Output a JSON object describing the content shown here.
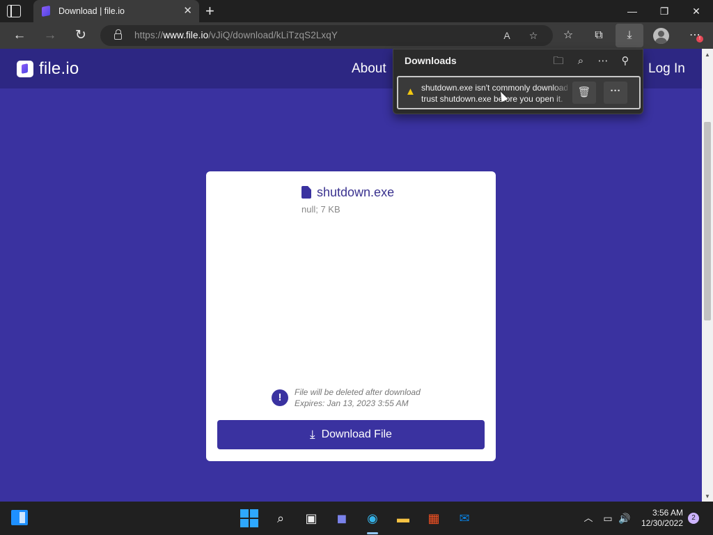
{
  "browser": {
    "tab_title": "Download | file.io",
    "url_prefix": "https://",
    "url_host": "www.file.io",
    "url_path": "/vJiQ/download/kLiTzqS2LxqY"
  },
  "site": {
    "logo_text": "file.io",
    "nav_about": "About",
    "nav_login": "Log In"
  },
  "file": {
    "name": "shutdown.exe",
    "meta": "null; 7 KB",
    "notice_line1": "File will be deleted after download",
    "notice_line2": "Expires: Jan 13, 2023 3:55 AM",
    "download_label": "Download File"
  },
  "downloads_flyout": {
    "title": "Downloads",
    "item_line1": "shutdown.exe isn't commonly downloaded",
    "item_line2": "trust shutdown.exe before you open it."
  },
  "taskbar": {
    "time": "3:56 AM",
    "date": "12/30/2022",
    "notification_count": "2"
  },
  "colors": {
    "page_background": "#3a32a0",
    "header_background": "#2d2783",
    "accent": "#3a32a0",
    "warning": "#f2c811"
  }
}
